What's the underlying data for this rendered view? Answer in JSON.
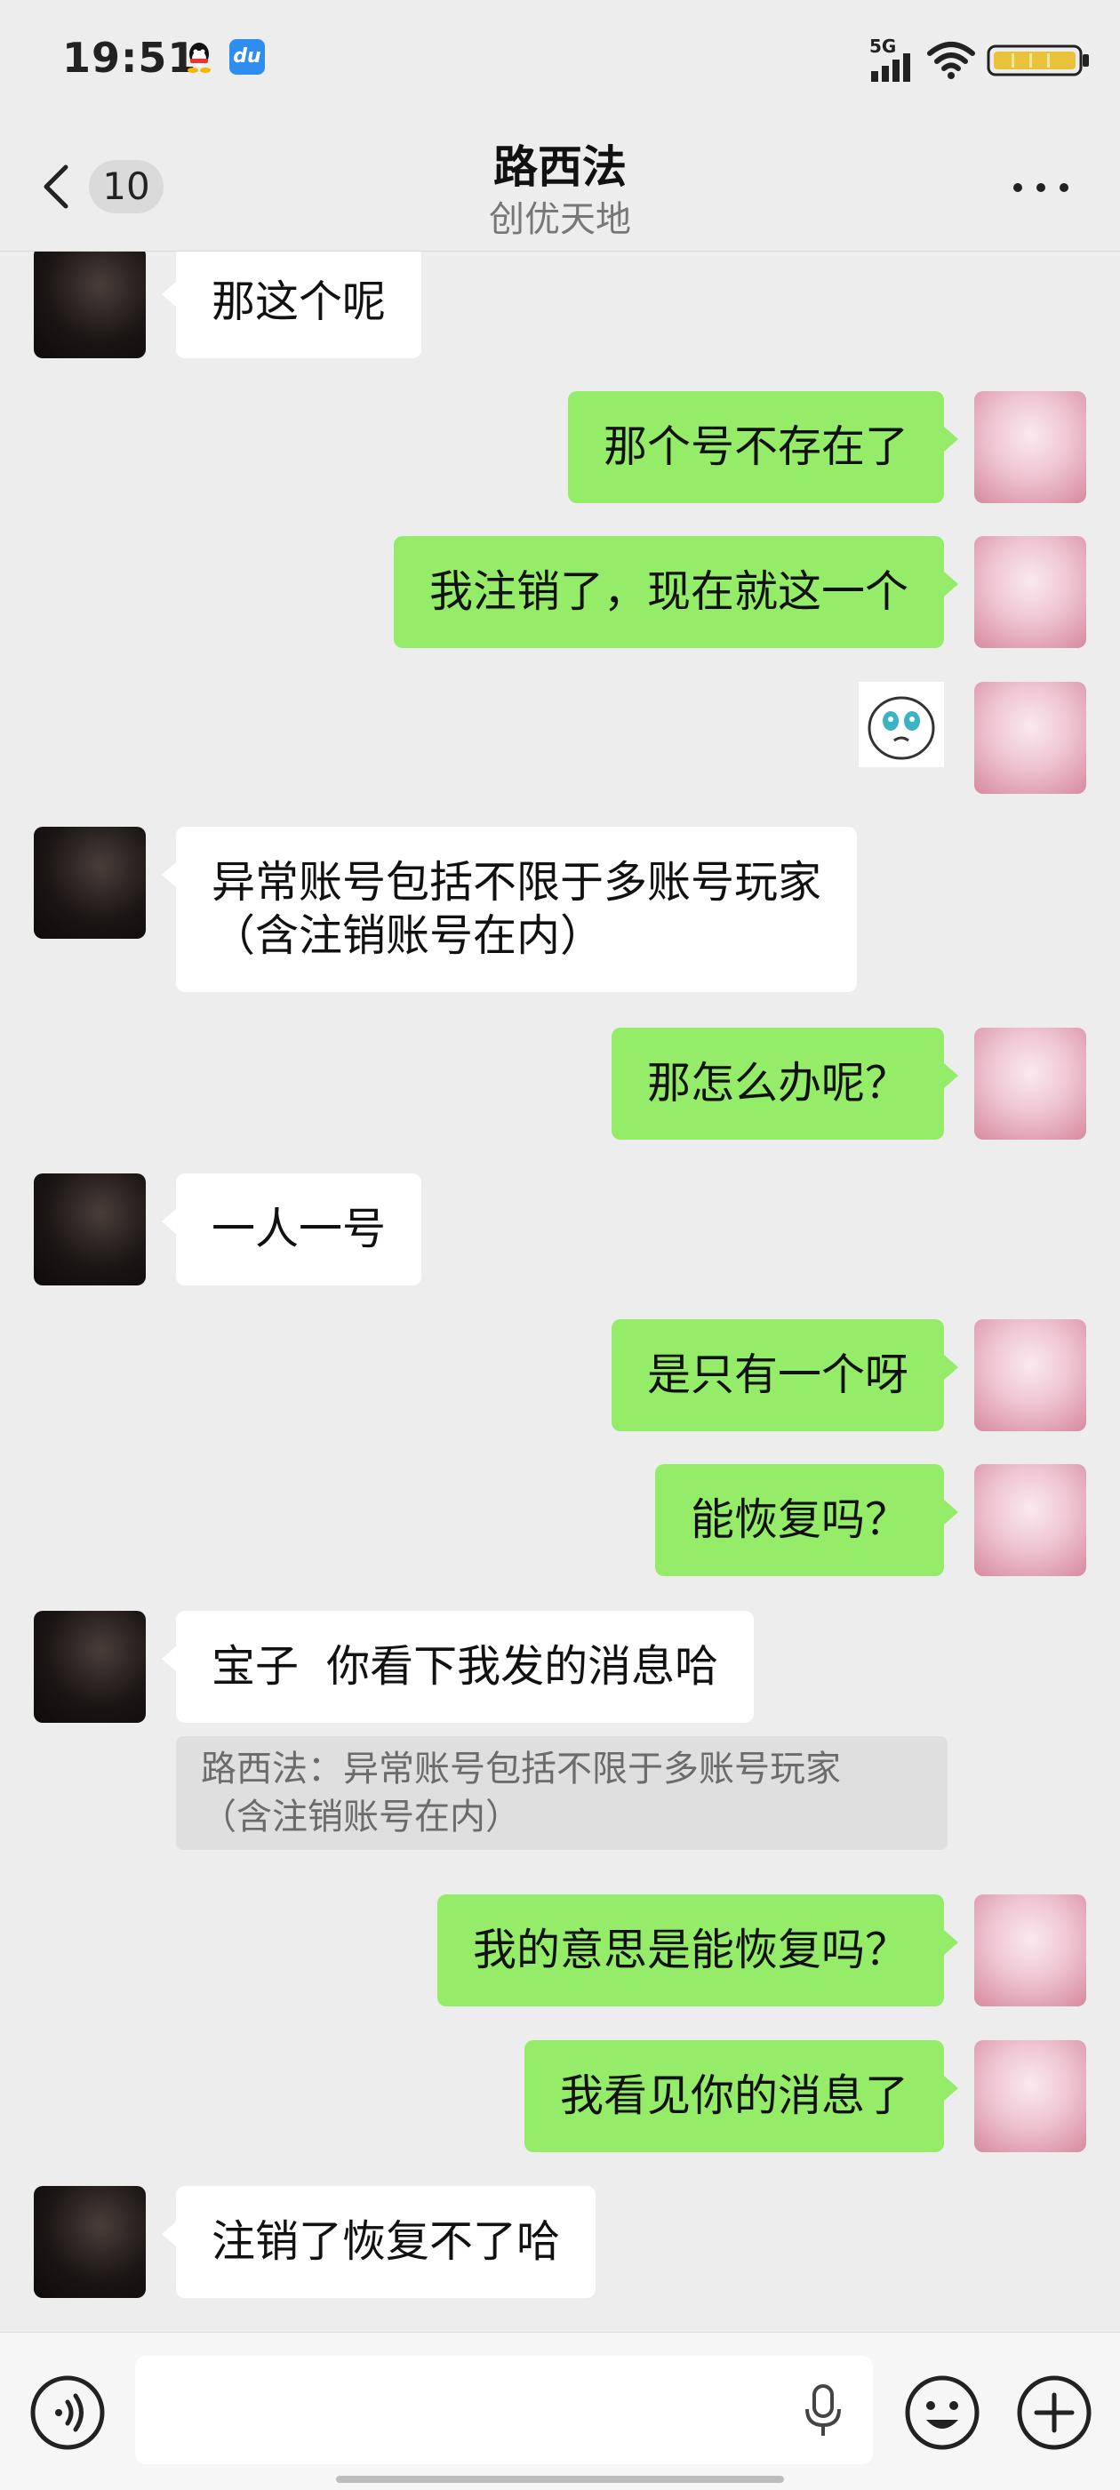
{
  "status_bar": {
    "time": "19:51",
    "network_label": "5G",
    "apps": [
      "qq-icon",
      "baidu-icon"
    ],
    "battery_color": "#e8c23a"
  },
  "header": {
    "back_icon": "chevron-left-icon",
    "unread_count": "10",
    "title": "路西法",
    "subtitle": "创优天地",
    "more_icon": "more-dots-icon"
  },
  "colors": {
    "background": "#ededed",
    "sent_bubble": "#95ec69",
    "received_bubble": "#ffffff",
    "quote_bg": "#dfdfdf"
  },
  "messages": [
    {
      "side": "left",
      "text": "那这个呢"
    },
    {
      "side": "right",
      "text": "那个号不存在了"
    },
    {
      "side": "right",
      "text": "我注销了，现在就这一个"
    },
    {
      "side": "right",
      "type": "sticker",
      "icon": "crying-face-sticker"
    },
    {
      "side": "left",
      "text": "异常账号包括不限于多账号玩家\n（含注销账号在内）"
    },
    {
      "side": "right",
      "text": "那怎么办呢？"
    },
    {
      "side": "left",
      "text": "一人一号"
    },
    {
      "side": "right",
      "text": "是只有一个呀"
    },
    {
      "side": "right",
      "text": "能恢复吗？"
    },
    {
      "side": "left",
      "text": "宝子  你看下我发的消息哈",
      "quote": "路西法：异常账号包括不限于多账号玩家\n（含注销账号在内）"
    },
    {
      "side": "right",
      "text": "我的意思是能恢复吗？"
    },
    {
      "side": "right",
      "text": "我看见你的消息了"
    },
    {
      "side": "left",
      "text": "注销了恢复不了哈"
    }
  ],
  "input_bar": {
    "voice_icon": "voice-icon",
    "placeholder": "",
    "mic_icon": "microphone-icon",
    "emoji_icon": "emoji-icon",
    "plus_icon": "plus-icon"
  }
}
